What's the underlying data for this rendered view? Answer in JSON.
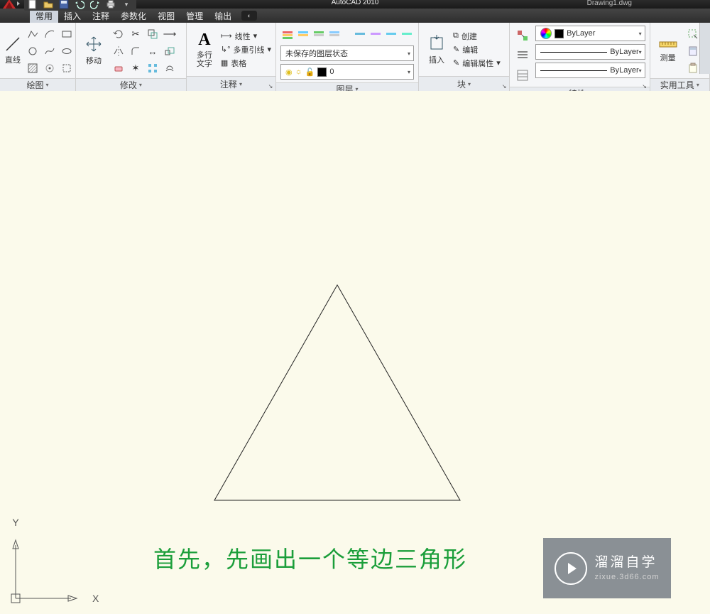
{
  "titlebar": {
    "title": "AutoCAD 2010",
    "subtitle": "Drawing1.dwg"
  },
  "qat": {
    "new": "□",
    "open": "▭",
    "save": "▭",
    "undo": "↶",
    "redo": "↷",
    "print": "⎙",
    "dd": "▾"
  },
  "menubar": {
    "items": [
      "常用",
      "插入",
      "注释",
      "参数化",
      "视图",
      "管理",
      "输出"
    ],
    "active_index": 0,
    "extra_icon": "◑"
  },
  "ribbon": {
    "panels": [
      {
        "key": "draw",
        "label": "绘图",
        "big": {
          "icon": "╱",
          "cap": "直线"
        }
      },
      {
        "key": "modify",
        "label": "修改",
        "big": {
          "icon": "✥",
          "cap": "移动"
        }
      },
      {
        "key": "annotate",
        "label": "注释",
        "big": {
          "icon": "A",
          "cap": "多行\n文字"
        },
        "rows": [
          {
            "icon": "⟼",
            "txt": "线性"
          },
          {
            "icon": "↳",
            "txt": "多重引线"
          },
          {
            "icon": "▦",
            "txt": "表格"
          }
        ]
      },
      {
        "key": "layer",
        "label": "图层",
        "combo1": "未保存的图层状态",
        "layer_name": "0"
      },
      {
        "key": "block",
        "label": "块",
        "big": {
          "icon": "⧉",
          "cap": "插入"
        },
        "rows": [
          {
            "icon": "⧉",
            "txt": "创建"
          },
          {
            "icon": "✎",
            "txt": "编辑"
          },
          {
            "icon": "✎",
            "txt": "编辑属性"
          }
        ]
      },
      {
        "key": "props",
        "label": "特性",
        "bylayer": "ByLayer"
      },
      {
        "key": "utils",
        "label": "实用工具",
        "big": {
          "icon": "⟷",
          "cap": "测量"
        }
      }
    ]
  },
  "canvas": {
    "step_text": "首先，先画出一个等边三角形",
    "ucs": {
      "x_label": "X",
      "y_label": "Y"
    }
  },
  "watermark": {
    "line1": "溜溜自学",
    "line2": "zixue.3d66.com"
  }
}
